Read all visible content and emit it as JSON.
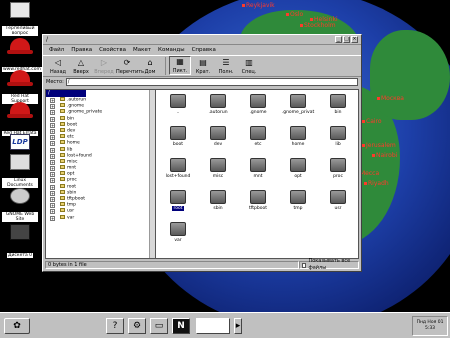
{
  "desktop": {
    "icons": [
      {
        "label": "Терпеливый вопрос"
      },
      {
        "label": "www.redhat.com"
      },
      {
        "label": "Red Hat Support"
      },
      {
        "label": "Red Hat Errata"
      },
      {
        "label": "LDP"
      },
      {
        "label": "Linux Documents"
      },
      {
        "label": "GNOME Web Site"
      },
      {
        "label": "Дискета 0"
      }
    ],
    "cities": [
      "Reykjavik",
      "Oslo",
      "Helsinki",
      "Stockholm",
      "Москва",
      "Cairo",
      "Jerusalem",
      "Nairobi",
      "Mecca",
      "Riyadh"
    ]
  },
  "window": {
    "title": "/",
    "menu": [
      "Файл",
      "Правка",
      "Свойства",
      "Макет",
      "Команды",
      "Справка"
    ],
    "toolbar": [
      {
        "label": "Назад",
        "icon": "◁"
      },
      {
        "label": "Вверх",
        "icon": "△"
      },
      {
        "label": "Вперед",
        "icon": "▷"
      },
      {
        "label": "Перечтить",
        "icon": "⟳"
      },
      {
        "label": "Дом",
        "icon": "⌂"
      },
      {
        "label": "Пикт.",
        "icon": "▦"
      },
      {
        "label": "Крат.",
        "icon": "▤"
      },
      {
        "label": "Полн.",
        "icon": "☰"
      },
      {
        "label": "Спец.",
        "icon": "▥"
      }
    ],
    "location_label": "Место:",
    "location_value": "/",
    "tree": {
      "root": "/",
      "items": [
        ".autorun",
        ".gnome",
        ".gnome_private",
        "bin",
        "boot",
        "dev",
        "etc",
        "home",
        "lib",
        "lost+found",
        "misc",
        "mnt",
        "opt",
        "proc",
        "root",
        "sbin",
        "tftpboot",
        "tmp",
        "usr",
        "var"
      ]
    },
    "files": [
      "..",
      ".autorun",
      ".gnome",
      ".gnome_privat",
      "bin",
      "boot",
      "dev",
      "etc",
      "home",
      "lib",
      "lost+found",
      "misc",
      "mnt",
      "opt",
      "proc",
      "root",
      "sbin",
      "tftpboot",
      "tmp",
      "usr",
      "var"
    ],
    "selected_file": "root",
    "status_left": "0 bytes in 1 file",
    "status_right": "Показывать все файлы"
  },
  "taskbar": {
    "clock_line1": "Пнд Ноя 01",
    "clock_line2": "5:33"
  }
}
